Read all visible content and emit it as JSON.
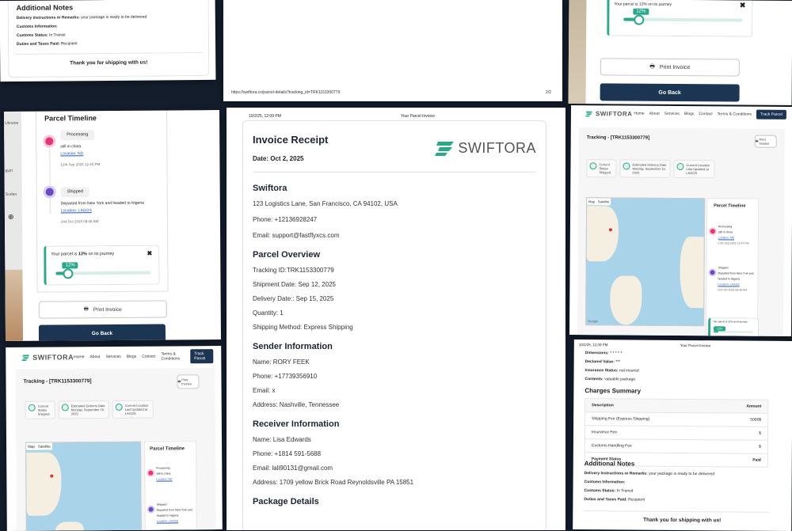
{
  "panel1": {
    "heading": "Additional Notes",
    "rows": [
      {
        "label": "Delivery Instructions or Remarks:",
        "value": " your package is ready to be delivered"
      },
      {
        "label": "Customs Information:",
        "value": ""
      },
      {
        "label": "Customs Status:",
        "value": " In Transit"
      },
      {
        "label": "Duties and Taxes Paid:",
        "value": " Recipient"
      }
    ],
    "thanks": "Thank you for shipping with us!"
  },
  "panel2": {
    "url": "https://swiftora.co/parcel-details?tracking_id=TRK1153300779",
    "page": "2/2"
  },
  "panel3": {
    "progress_label": "Your parcel is 12% on its journey",
    "progress_pct": 12,
    "progress_badge": "12%",
    "print_button": "Print Invoice",
    "back_button": "Go Back"
  },
  "panel4": {
    "title": "Parcel Timeline",
    "side_labels": [
      "Ukraine",
      "gypt",
      "Sudan"
    ],
    "events": [
      {
        "status": "Processing",
        "desc": "still in china",
        "location": "Location: ND",
        "date": "12th Sep 2025 12:43 PM"
      },
      {
        "status": "Shipped",
        "desc": "Departed from New York and headed to Nigeria",
        "location": "Location: LAGOS",
        "date": "2nd Oct 2025 09:36 AM"
      }
    ],
    "progress_label_pre": "Your parcel is ",
    "progress_label_pct": "12%",
    "progress_label_post": " on its journey",
    "progress_pct": 12,
    "progress_badge": "12%",
    "print_button": "Print Invoice",
    "back_button": "Go Back"
  },
  "panel5": {
    "date_time": "10/2/25, 12:09 PM",
    "doc_title": "Your Parcel Invoice",
    "heading": "Invoice Receipt",
    "date_label": "Date: Oct 2, 2025",
    "brand": "SWIFTORA",
    "company": {
      "title": "Swiftora",
      "address": "123 Logistics Lane, San Francisco, CA 94102, USA",
      "phone": "Phone: +12136928247",
      "email": "Email: support@fastflyxcs.com"
    },
    "parcel": {
      "title": "Parcel Overview",
      "tracking": "Tracking ID:TRK1153300779",
      "shipment": "Shipment Date: Sep 12, 2025",
      "delivery": "Delivery Date:: Sep 15, 2025",
      "quantity": "Quantity: 1",
      "method": "Shipping Method: Express Shipping"
    },
    "sender": {
      "title": "Sender Information",
      "name": "Name: RORY FEEK",
      "phone": "Phone: +17739356910",
      "email": "Email: x",
      "address": "Address: Nashville, Tennessee"
    },
    "receiver": {
      "title": "Receiver Information",
      "name": "Name: Lisa Edwards",
      "phone": "Phone: +1814 591-5688",
      "email": "Email: lali90131@gmail.com",
      "address": "Address: 1709 yellow Brick Road Reynoldsville PA 15851"
    },
    "package_title": "Package Details"
  },
  "panel6": {
    "brand": "SWIFTORA",
    "nav": [
      "Home",
      "About",
      "Services",
      "Blogs",
      "Contact",
      "Terms & Conditions"
    ],
    "track_button": "Track Parcel",
    "tracking_title": "Tracking - [TRK1153300779]",
    "print_button": "Print Invoice",
    "cards": [
      {
        "label": "Current Status",
        "value": "Shipped"
      },
      {
        "label": "Estimated Delivery Date",
        "value": "Monday, September 15, 2025"
      },
      {
        "label": "Current Location",
        "value": "Last Updated at LAGOS"
      }
    ],
    "map_tabs": [
      "Map",
      "Satellite"
    ],
    "timeline_title": "Parcel Timeline",
    "events": [
      {
        "status": "Processing",
        "desc": "still in china",
        "location": "Location: ND",
        "date": "12th Sep 2025 12:43 PM"
      },
      {
        "status": "Shipped",
        "desc": "Departed from New York and headed to Nigeria",
        "location": "Location: LAGOS",
        "date": "2nd Oct 2025 09:36 AM"
      }
    ],
    "progress_label": "Your parcel is 12% on its journey",
    "progress_pct": 12,
    "progress_badge": "12%",
    "map_footer": "Google"
  },
  "panel7": {
    "brand": "SWIFTORA",
    "nav": [
      "Home",
      "About",
      "Services",
      "Blogs",
      "Contact",
      "Terms & Conditions"
    ],
    "track_button": "Track Parcel",
    "tracking_title": "Tracking - [TRK1153300779]",
    "print_button": "Print Invoice",
    "cards": [
      {
        "label": "Current Status",
        "value": "Shipped"
      },
      {
        "label": "Estimated Delivery Date",
        "value": "Monday, September 15, 2025"
      },
      {
        "label": "Current Location",
        "value": "Last Updated at LAGOS"
      }
    ],
    "map_tabs": [
      "Map",
      "Satellite"
    ],
    "timeline_title": "Parcel Timeline",
    "events": [
      {
        "status": "Processing",
        "desc": "still in china",
        "location": "Location: ND"
      },
      {
        "status": "Shipped",
        "desc": "Departed from New York and headed to Nigeria",
        "location": "Location: LAGOS"
      }
    ]
  },
  "panel8": {
    "date_time": "10/2/25, 12:09 PM",
    "doc_title": "Your Parcel Invoice",
    "dimensions": "Dimensions: ",
    "dimensions_value": "* * * * *",
    "declared": "Declared Value: ",
    "declared_value": "***",
    "insurance": "Insurance Status: ",
    "insurance_value": "not insured",
    "contents": "Contents: ",
    "contents_value": "valuable package",
    "charges_title": "Charges Summary",
    "table_head": [
      "Description",
      "Amount"
    ],
    "table_rows": [
      {
        "desc": "Shipping Fee (Express Shipping)",
        "amount": "5000$"
      },
      {
        "desc": "Insurance Fee",
        "amount": "$"
      },
      {
        "desc": "Customs Handling Fee",
        "amount": "$"
      },
      {
        "desc": "Payment Status",
        "amount": "Paid"
      }
    ],
    "notes_title": "Additional Notes",
    "notes": [
      {
        "label": "Delivery Instructions or Remarks:",
        "value": " your package is ready to be delivered"
      },
      {
        "label": "Customs Information:",
        "value": ""
      },
      {
        "label": "Customs Status:",
        "value": " In Transit"
      },
      {
        "label": "Duties and Taxes Paid:",
        "value": " Recipient"
      }
    ],
    "thanks": "Thank you for shipping with us!"
  },
  "colors": {
    "background": "#131d2b",
    "accent": "#2aa88a",
    "dark_button": "#1c3553",
    "processing": "#e8337a",
    "shipped": "#6a4bc4"
  },
  "icons": [
    "printer-icon",
    "close-icon",
    "processing-icon",
    "shipped-icon",
    "swiftora-logo-icon",
    "locate-icon",
    "status-icon"
  ]
}
